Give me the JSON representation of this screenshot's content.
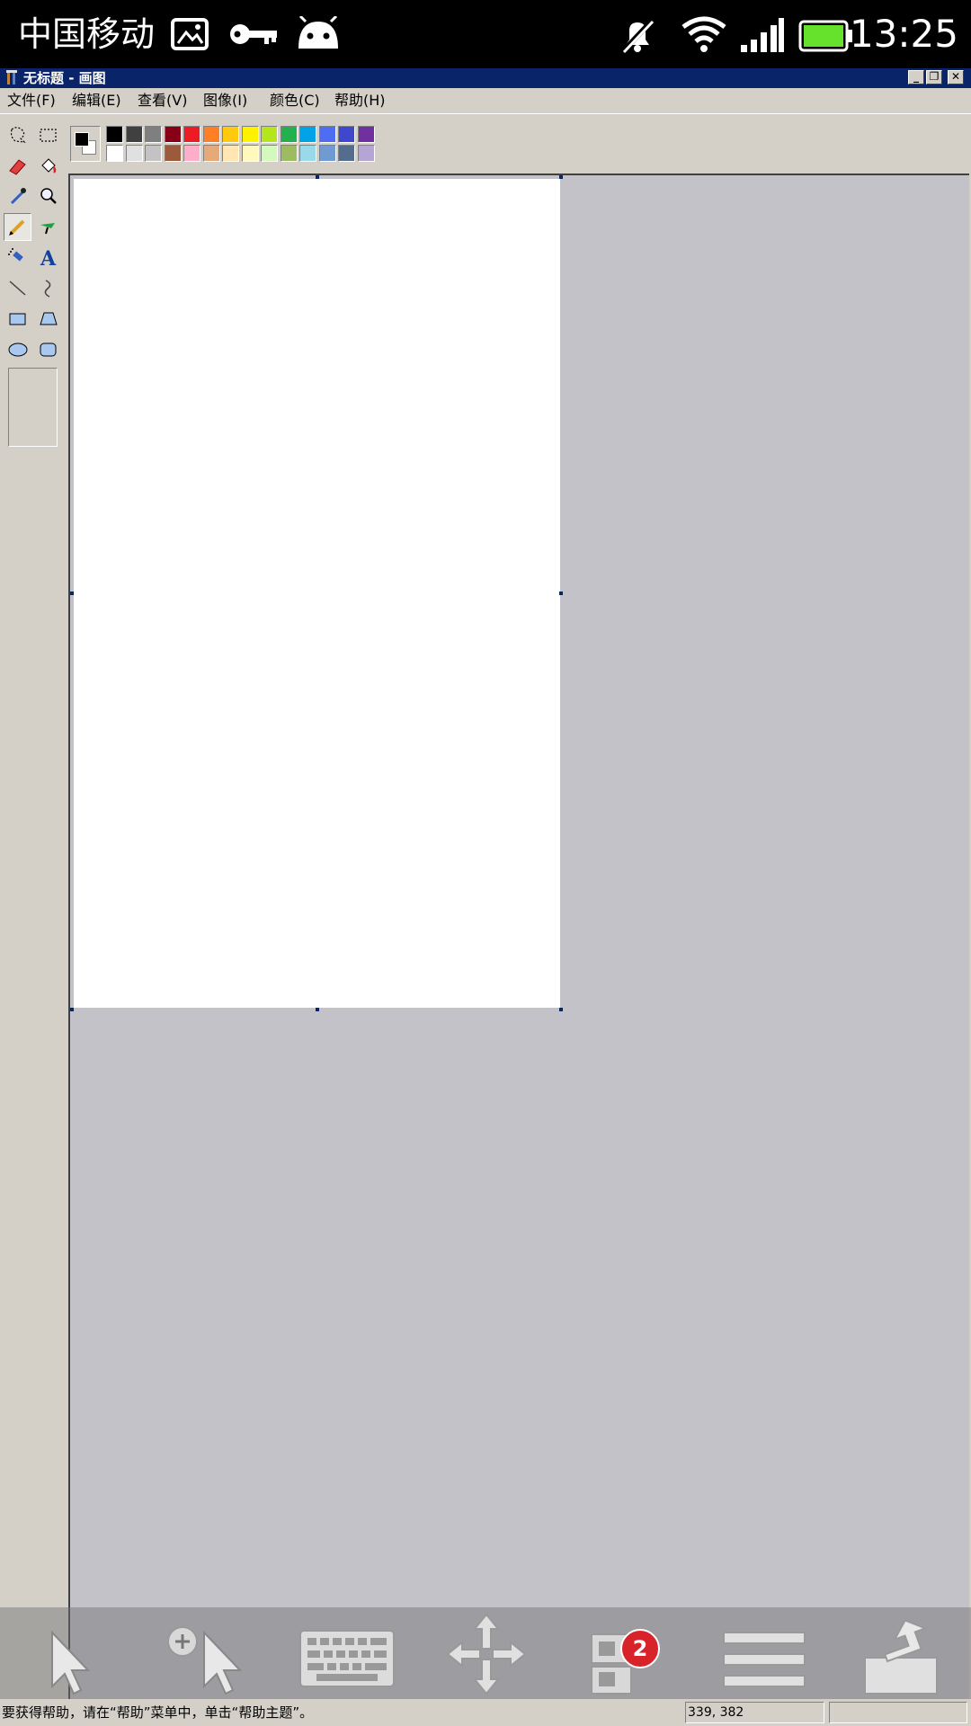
{
  "status_bar": {
    "carrier": "中国移动",
    "time": "13:25",
    "icons": [
      "image-icon",
      "key-icon",
      "android-icon",
      "mute-icon",
      "wifi-icon",
      "signal-icon",
      "battery-icon"
    ]
  },
  "window": {
    "title": "无标题 - 画图",
    "buttons": [
      "minimize",
      "restore",
      "close"
    ]
  },
  "menu": {
    "items": [
      {
        "label": "文件(F)"
      },
      {
        "label": "编辑(E)"
      },
      {
        "label": "查看(V)"
      },
      {
        "label": "图像(I)"
      },
      {
        "label": "颜色(C)"
      },
      {
        "label": "帮助(H)"
      }
    ]
  },
  "toolbox": {
    "tools": [
      "free-select",
      "rect-select",
      "eraser",
      "fill",
      "color-picker",
      "magnifier",
      "pencil",
      "brush",
      "airbrush",
      "text",
      "line",
      "curve",
      "rectangle",
      "polygon",
      "ellipse",
      "rounded-rectangle"
    ],
    "active": "pencil"
  },
  "palette": {
    "foreground": "#000000",
    "background": "#ffffff",
    "row1": [
      "#000000",
      "#404040",
      "#7f7f7f",
      "#880015",
      "#ed1c24",
      "#ff7f27",
      "#ffc90e",
      "#fff200",
      "#b5e61d",
      "#22b14c",
      "#00a2e8",
      "#4d6df3",
      "#3f48cc",
      "#7030a0"
    ],
    "row2": [
      "#ffffff",
      "#e0e0e0",
      "#c3c3c3",
      "#9c5a3c",
      "#ffaec9",
      "#e5aa7a",
      "#ffe6b3",
      "#fff9bd",
      "#d3f9bc",
      "#9dbb61",
      "#99d9ea",
      "#709ad1",
      "#546d8e",
      "#b5a5d5"
    ]
  },
  "status": {
    "message": "要获得帮助，请在“帮助”菜单中，单击“帮助主题”。",
    "coords": "339, 382"
  },
  "remote_toolbar": {
    "buttons": [
      "pointer",
      "zoom-pointer",
      "keyboard",
      "move",
      "windows",
      "menu",
      "exit"
    ],
    "windows_badge": "2"
  }
}
